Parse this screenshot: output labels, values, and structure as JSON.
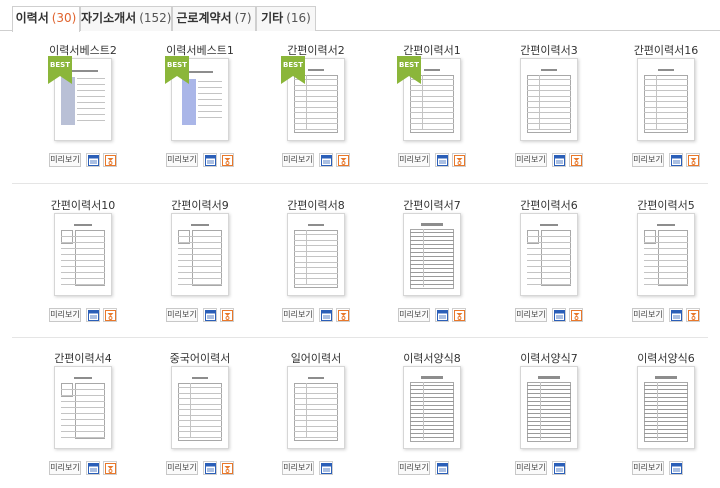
{
  "tabs": [
    {
      "label": "이력서",
      "count": "(30)",
      "active": true
    },
    {
      "label": "자기소개서",
      "count": "(152)",
      "active": false
    },
    {
      "label": "근로계약서",
      "count": "(7)",
      "active": false
    },
    {
      "label": "기타",
      "count": "(16)",
      "active": false
    }
  ],
  "preview_label": "미리보기",
  "best_label": "BEST",
  "colors": {
    "best": "#8bb63a",
    "word": "#2b5fb8",
    "hwp": "#e8782b",
    "active_count": "#e0632e"
  },
  "icons": {
    "word": "word-doc-icon",
    "hwp": "hwp-doc-icon"
  },
  "rows": [
    {
      "items": [
        {
          "title": "이력서베스트2",
          "best": true,
          "style": "color",
          "hwp": true
        },
        {
          "title": "이력서베스트1",
          "best": true,
          "style": "blue",
          "hwp": true
        },
        {
          "title": "간편이력서2",
          "best": true,
          "style": "lines",
          "hwp": true
        },
        {
          "title": "간편이력서1",
          "best": true,
          "style": "lines",
          "hwp": true
        },
        {
          "title": "간편이력서3",
          "best": false,
          "style": "lines",
          "hwp": true
        },
        {
          "title": "간편이력서16",
          "best": false,
          "style": "lines",
          "hwp": true
        }
      ]
    },
    {
      "items": [
        {
          "title": "간편이력서10",
          "best": false,
          "style": "photo",
          "hwp": true
        },
        {
          "title": "간편이력서9",
          "best": false,
          "style": "photo",
          "hwp": true
        },
        {
          "title": "간편이력서8",
          "best": false,
          "style": "lines",
          "hwp": true
        },
        {
          "title": "간편이력서7",
          "best": false,
          "style": "dense",
          "hwp": true
        },
        {
          "title": "간편이력서6",
          "best": false,
          "style": "photo",
          "hwp": true
        },
        {
          "title": "간편이력서5",
          "best": false,
          "style": "photo",
          "hwp": true
        }
      ]
    },
    {
      "items": [
        {
          "title": "간편이력서4",
          "best": false,
          "style": "photo",
          "hwp": true
        },
        {
          "title": "중국어이력서",
          "best": false,
          "style": "lines",
          "hwp": true
        },
        {
          "title": "일어이력서",
          "best": false,
          "style": "lines",
          "hwp": false
        },
        {
          "title": "이력서양식8",
          "best": false,
          "style": "dense",
          "hwp": false
        },
        {
          "title": "이력서양식7",
          "best": false,
          "style": "dense",
          "hwp": false
        },
        {
          "title": "이력서양식6",
          "best": false,
          "style": "dense",
          "hwp": false
        }
      ]
    }
  ]
}
